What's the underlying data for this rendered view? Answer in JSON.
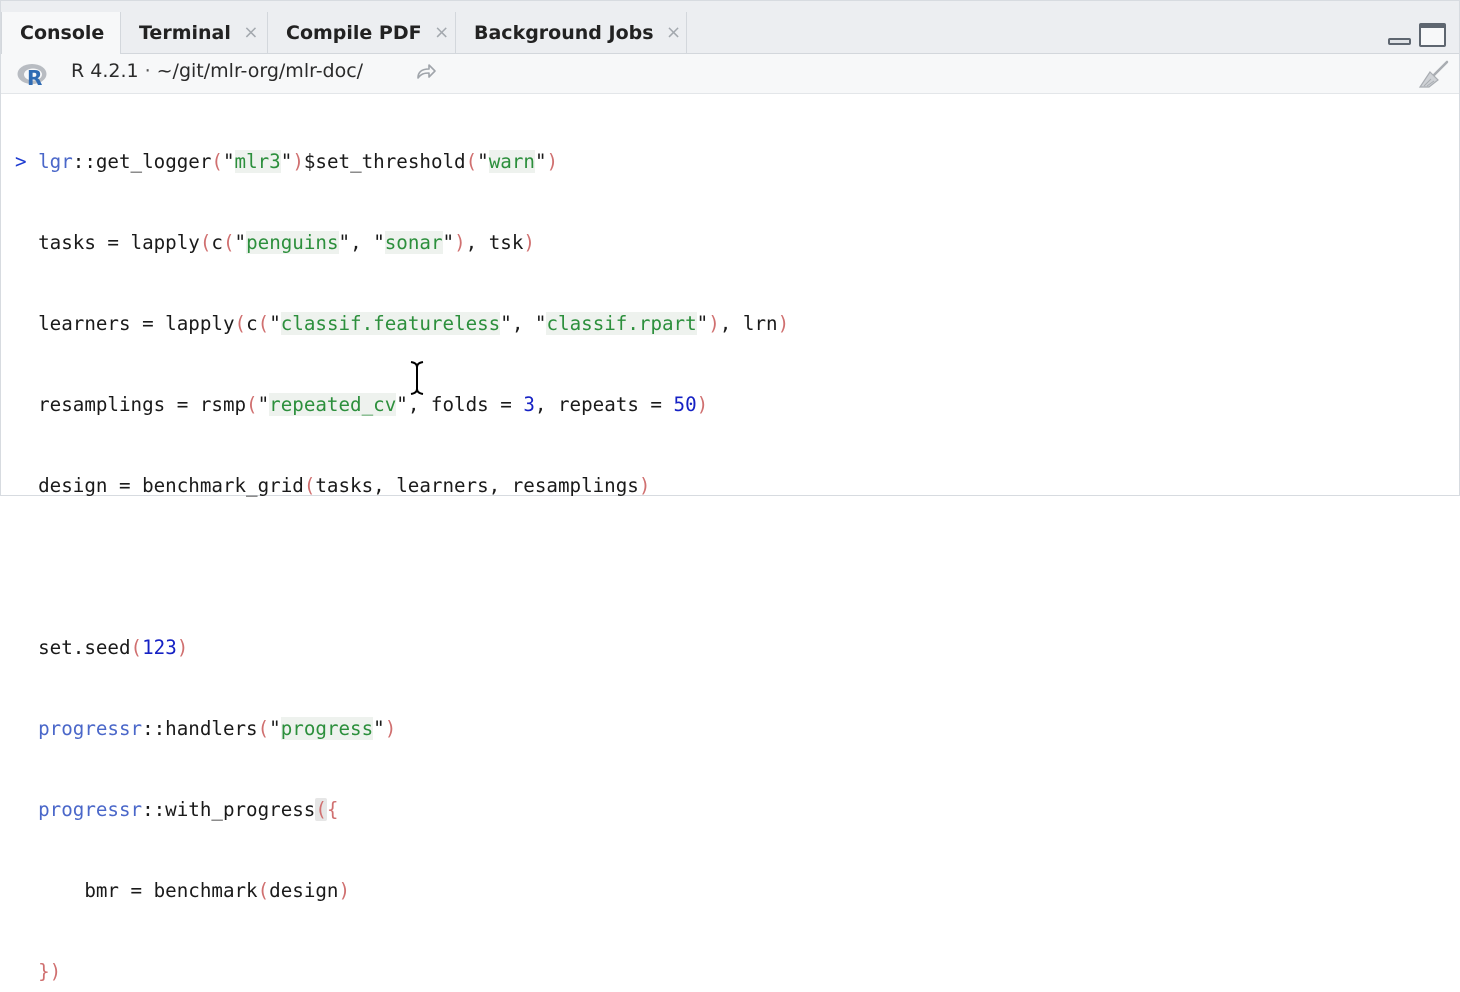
{
  "tabs": [
    {
      "label": "Console",
      "active": true,
      "closable": false
    },
    {
      "label": "Terminal",
      "active": false,
      "closable": true
    },
    {
      "label": "Compile PDF",
      "active": false,
      "closable": true
    },
    {
      "label": "Background Jobs",
      "active": false,
      "closable": true
    }
  ],
  "close_glyph": "×",
  "pathbar": {
    "r_version": "R 4.2.1",
    "separator": "·",
    "working_dir": "~/git/mlr-org/mlr-doc/"
  },
  "icons": {
    "r_logo": "r-logo-icon",
    "goto_dir": "goto-directory-icon",
    "clear_console": "broom-icon",
    "minimize": "minimize-pane-icon",
    "maximize": "maximize-pane-icon",
    "text_cursor": "ibeam-cursor-icon"
  },
  "console": {
    "prompt": ">",
    "lines": [
      "lgr::get_logger(\"mlr3\")$set_threshold(\"warn\")",
      "tasks = lapply(c(\"penguins\", \"sonar\"), tsk)",
      "learners = lapply(c(\"classif.featureless\", \"classif.rpart\"), lrn)",
      "resamplings = rsmp(\"repeated_cv\", folds = 3, repeats = 50)",
      "design = benchmark_grid(tasks, learners, resamplings)",
      "",
      "set.seed(123)",
      "progressr::handlers(\"progress\")",
      "progressr::with_progress({",
      "    bmr = benchmark(design)",
      "})"
    ]
  },
  "colors": {
    "prompt": "#1d3bd1",
    "string": "#2c8f3c",
    "number": "#1521c4",
    "paren": "#d07070",
    "namespace": "#4a67c9"
  }
}
